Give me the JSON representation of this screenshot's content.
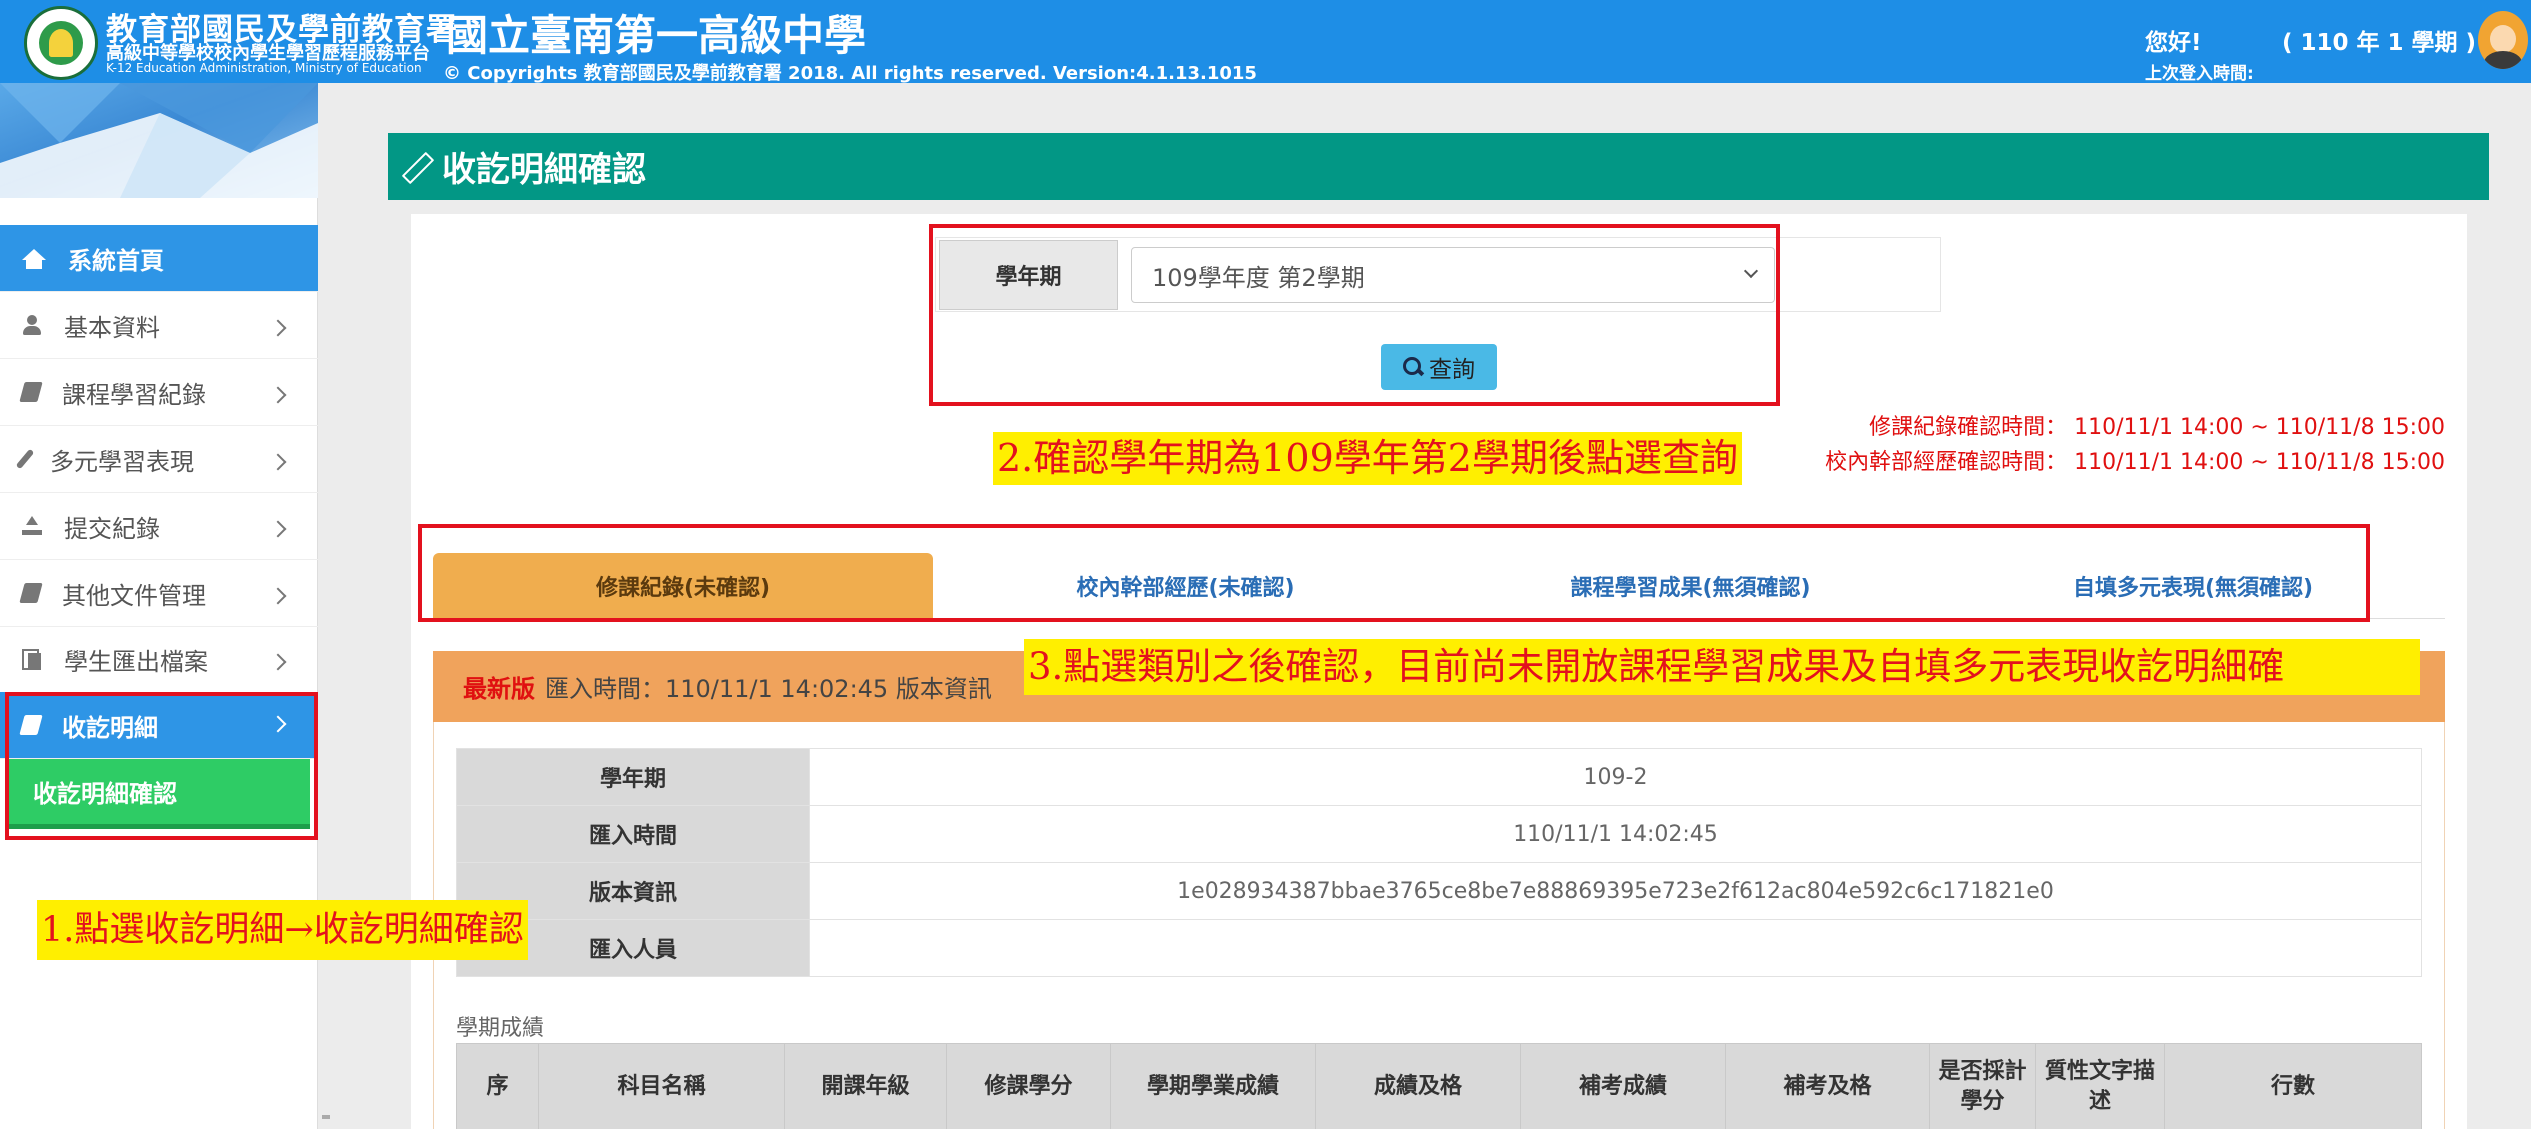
{
  "header": {
    "agency_title": "教育部國民及學前教育署",
    "agency_subtitle": "高級中等學校校內學生學習歷程服務平台",
    "agency_english": "K-12 Education Administration, Ministry of Education",
    "school_name": "國立臺南第一高級中學",
    "copyright": "© Copyrights 教育部國民及學前教育署 2018. All rights reserved. Version:4.1.13.1015",
    "greeting": "您好!",
    "current_semester": "( 110 年 1 學期 )",
    "last_login_label": "上次登入時間:"
  },
  "sidebar": {
    "items": [
      {
        "label": "系統首頁",
        "icon": "home-icon"
      },
      {
        "label": "基本資料",
        "icon": "user-icon"
      },
      {
        "label": "課程學習紀錄",
        "icon": "book-icon"
      },
      {
        "label": "多元學習表現",
        "icon": "brush-icon"
      },
      {
        "label": "提交紀錄",
        "icon": "upload-icon"
      },
      {
        "label": "其他文件管理",
        "icon": "book-icon"
      },
      {
        "label": "學生匯出檔案",
        "icon": "copy-icon"
      },
      {
        "label": "收訖明細",
        "icon": "book-icon"
      }
    ],
    "sub_item": "收訖明細確認"
  },
  "page": {
    "title": "收訖明細確認"
  },
  "filter": {
    "label": "學年期",
    "selected_semester": "109學年度 第2學期",
    "query_button": "查詢"
  },
  "confirm_times": {
    "course_record": "修課紀錄確認時間： 110/11/1 14:00 ~ 110/11/8 15:00",
    "cadre_record": "校內幹部經歷確認時間： 110/11/1 14:00 ~ 110/11/8 15:00"
  },
  "annotations": {
    "step1": "1.點選收訖明細→收訖明細確認",
    "step2": "2.確認學年期為109學年第2學期後點選查詢",
    "step3": "3.點選類別之後確認，目前尚未開放課程學習成果及自填多元表現收訖明細確"
  },
  "tabs": [
    {
      "label": "修課紀錄(未確認)",
      "active": true
    },
    {
      "label": "校內幹部經歷(未確認)",
      "active": false
    },
    {
      "label": "課程學習成果(無須確認)",
      "active": false
    },
    {
      "label": "自填多元表現(無須確認)",
      "active": false
    }
  ],
  "import_info": {
    "latest_badge": "最新版",
    "text": "匯入時間：110/11/1 14:02:45 版本資訊"
  },
  "info_table": [
    {
      "key": "學年期",
      "value": "109-2"
    },
    {
      "key": "匯入時間",
      "value": "110/11/1 14:02:45"
    },
    {
      "key": "版本資訊",
      "value": "1e028934387bbae3765ce8be7e88869395e723e2f612ac804e592c6c171821e0"
    },
    {
      "key": "匯入人員",
      "value": ""
    }
  ],
  "grades": {
    "caption": "學期成績",
    "columns": [
      "序",
      "科目名稱",
      "開課年級",
      "修課學分",
      "學期學業成績",
      "成績及格",
      "補考成績",
      "補考及格",
      "是否採計學分",
      "質性文字描述",
      "行數"
    ]
  },
  "colors": {
    "header_blue": "#1e8ee6",
    "sidebar_active": "#2e95e6",
    "sub_item_green": "#2ecc65",
    "page_header_teal": "#029785",
    "tab_active_orange": "#f0ad4e",
    "import_bar_orange": "#f0a35c",
    "annotation_red": "#e3111e",
    "annotation_yellow": "#ffef00"
  }
}
